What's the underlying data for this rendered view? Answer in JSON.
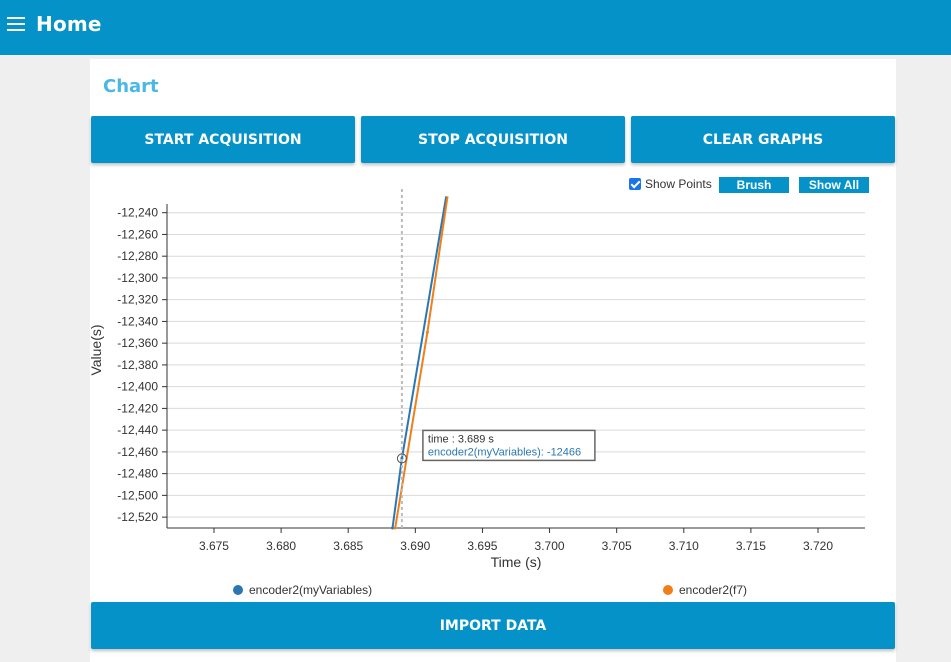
{
  "appbar": {
    "title": "Home"
  },
  "card": {
    "title": "Chart"
  },
  "buttons": {
    "start": "START ACQUISITION",
    "stop": "STOP ACQUISITION",
    "clear": "CLEAR GRAPHS",
    "import": "IMPORT DATA"
  },
  "toolbar": {
    "show_points_label": "Show Points",
    "show_points_checked": true,
    "brush_label": "Brush",
    "show_all_label": "Show All"
  },
  "chart_data": {
    "type": "line",
    "xlabel": "Time (s)",
    "ylabel": "Value(s)",
    "xlim": [
      3.6715,
      3.7235
    ],
    "ylim": [
      -12530,
      -12232
    ],
    "x_ticks": [
      3.675,
      3.68,
      3.685,
      3.69,
      3.695,
      3.7,
      3.705,
      3.71,
      3.715,
      3.72
    ],
    "x_tick_labels": [
      "3.675",
      "3.680",
      "3.685",
      "3.690",
      "3.695",
      "3.700",
      "3.705",
      "3.710",
      "3.715",
      "3.720"
    ],
    "y_ticks": [
      -12240,
      -12260,
      -12280,
      -12300,
      -12320,
      -12340,
      -12360,
      -12380,
      -12400,
      -12420,
      -12440,
      -12460,
      -12480,
      -12500,
      -12520
    ],
    "y_tick_labels": [
      "-12,240",
      "-12,260",
      "-12,280",
      "-12,300",
      "-12,320",
      "-12,340",
      "-12,360",
      "-12,380",
      "-12,400",
      "-12,420",
      "-12,440",
      "-12,460",
      "-12,480",
      "-12,500",
      "-12,520"
    ],
    "grid": true,
    "legend_position": "bottom",
    "series": [
      {
        "name": "encoder2(myVariables)",
        "color": "#2a77b4",
        "x": [
          3.6883,
          3.689,
          3.6923
        ],
        "y": [
          -12530,
          -12466,
          -12225
        ]
      },
      {
        "name": "encoder2(f7)",
        "color": "#f07f1a",
        "x": [
          3.6885,
          3.6909,
          3.6924
        ],
        "y": [
          -12530,
          -12350,
          -12225
        ]
      }
    ],
    "cursor": {
      "x": 3.689,
      "time_label": "time : 3.689 s",
      "value_label": "encoder2(myVariables): -12466",
      "point_y": -12466
    }
  }
}
